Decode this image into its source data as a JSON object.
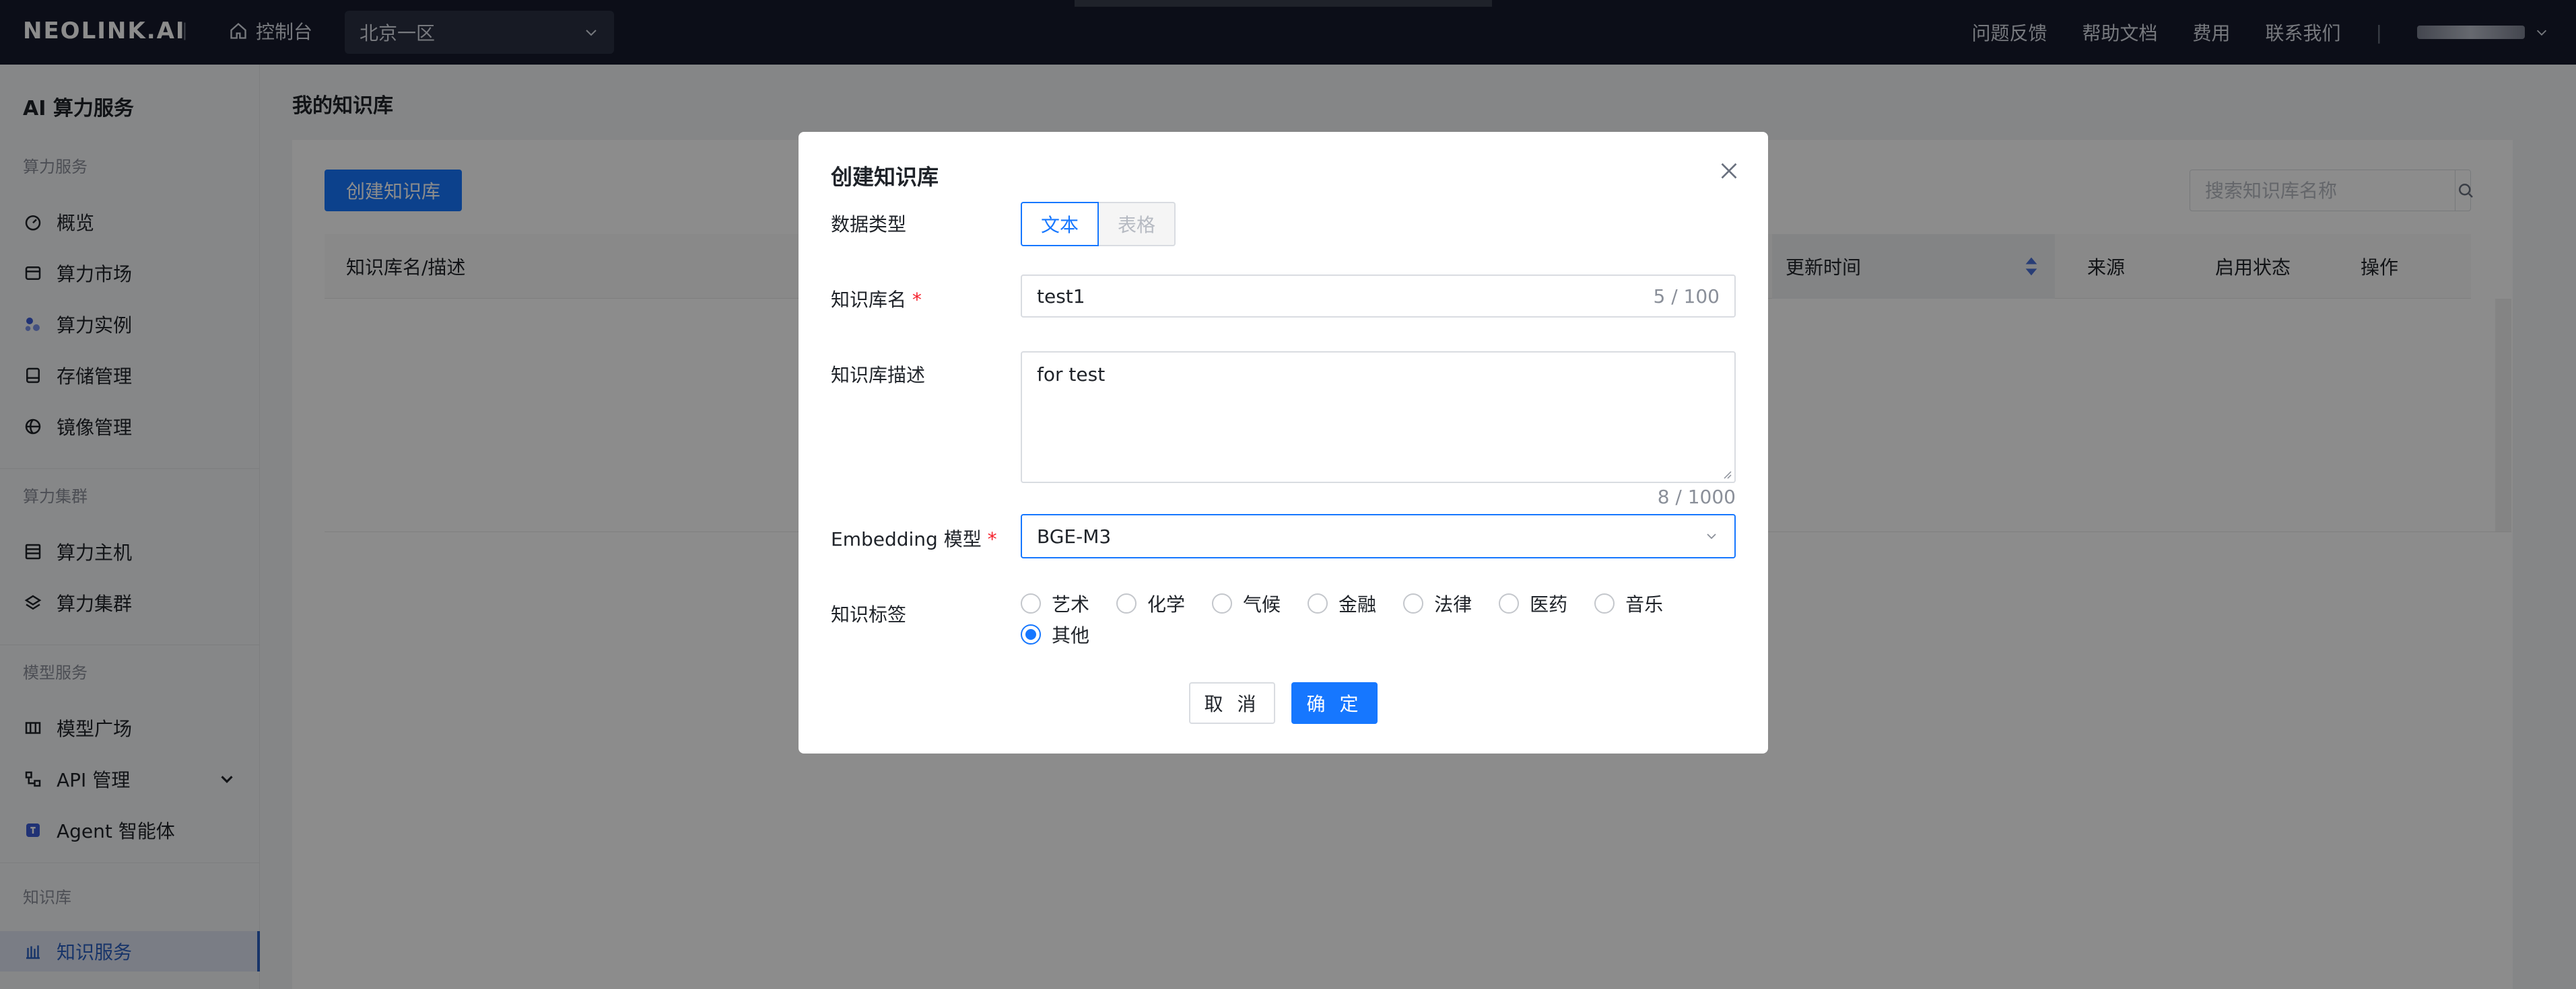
{
  "topbar": {
    "logo": "NEOLINK.AI",
    "separator": "|",
    "console_label": "控制台",
    "region": "北京一区",
    "links": [
      "问题反馈",
      "帮助文档",
      "费用",
      "联系我们"
    ]
  },
  "sidebar": {
    "title": "AI 算力服务",
    "groups": {
      "compute_service": "算力服务",
      "compute_cluster": "算力集群",
      "model_service": "模型服务",
      "knowledge_base": "知识库"
    },
    "items": {
      "overview": "概览",
      "market": "算力市场",
      "instances": "算力实例",
      "storage": "存储管理",
      "images": "镜像管理",
      "hosts": "算力主机",
      "clusters": "算力集群",
      "model_square": "模型广场",
      "api_management": "API 管理",
      "agent": "Agent 智能体",
      "knowledge_service": "知识服务"
    }
  },
  "main": {
    "title": "我的知识库",
    "create_button": "创建知识库",
    "search_placeholder": "搜索知识库名称",
    "table_headers": {
      "name": "知识库名/描述",
      "updated": "更新时间",
      "source": "来源",
      "status": "启用状态",
      "actions": "操作"
    }
  },
  "modal": {
    "title": "创建知识库",
    "data_type_label": "数据类型",
    "data_type_options": [
      "文本",
      "表格"
    ],
    "data_type_selected": "文本",
    "name_label": "知识库名",
    "name_value": "test1",
    "name_count": "5 / 100",
    "desc_label": "知识库描述",
    "desc_value": "for test",
    "desc_count": "8 / 1000",
    "embedding_label": "Embedding 模型",
    "embedding_value": "BGE-M3",
    "required_mark": "*",
    "tags_label": "知识标签",
    "tags": [
      "艺术",
      "化学",
      "气候",
      "金融",
      "法律",
      "医药",
      "音乐",
      "其他"
    ],
    "tag_selected": "其他",
    "cancel": "取 消",
    "confirm": "确 定"
  },
  "colors": {
    "primary": "#1677ff",
    "topbar": "#161b2c",
    "required": "#f5222d"
  }
}
